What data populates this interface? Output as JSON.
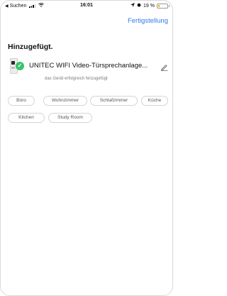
{
  "status_bar": {
    "back_label": "Suchen",
    "time": "16:01",
    "battery_text": "19 %",
    "battery_level": 0.19
  },
  "header": {
    "done_label": "Fertigstellung"
  },
  "section": {
    "title": "Hinzugefügt."
  },
  "device": {
    "name": "UNITEC WIFI Video-Türsprechanlage...",
    "subtitle": "das Gerät erfolgreich hinzugefügt"
  },
  "rooms": [
    "Büro",
    "Wohnzimmer",
    "Schlafzimmer",
    "Küche",
    "Kitchen",
    "Study Room"
  ],
  "colors": {
    "accent": "#2f7be8",
    "success": "#38c46a",
    "battery": "#f2b400"
  }
}
